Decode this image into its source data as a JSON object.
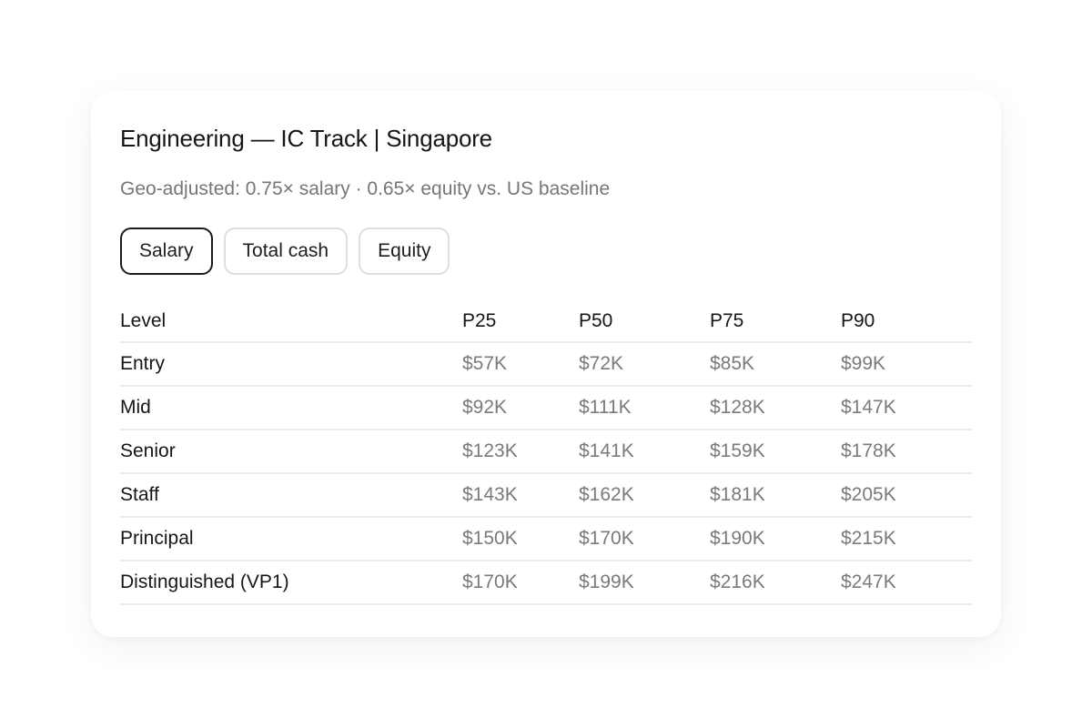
{
  "card": {
    "title": "Engineering — IC Track | Singapore",
    "subtitle": "Geo-adjusted: 0.75× salary · 0.65× equity vs. US baseline"
  },
  "tabs": [
    {
      "label": "Salary",
      "active": true
    },
    {
      "label": "Total cash",
      "active": false
    },
    {
      "label": "Equity",
      "active": false
    }
  ],
  "table": {
    "headers": [
      "Level",
      "P25",
      "P50",
      "P75",
      "P90"
    ],
    "rows": [
      {
        "level": "Entry",
        "p25": "$57K",
        "p50": "$72K",
        "p75": "$85K",
        "p90": "$99K"
      },
      {
        "level": "Mid",
        "p25": "$92K",
        "p50": "$111K",
        "p75": "$128K",
        "p90": "$147K"
      },
      {
        "level": "Senior",
        "p25": "$123K",
        "p50": "$141K",
        "p75": "$159K",
        "p90": "$178K"
      },
      {
        "level": "Staff",
        "p25": "$143K",
        "p50": "$162K",
        "p75": "$181K",
        "p90": "$205K"
      },
      {
        "level": "Principal",
        "p25": "$150K",
        "p50": "$170K",
        "p75": "$190K",
        "p90": "$215K"
      },
      {
        "level": "Distinguished (VP1)",
        "p25": "$170K",
        "p50": "$199K",
        "p75": "$216K",
        "p90": "$247K"
      }
    ]
  },
  "colors": {
    "active_tab_border": "#1a1a1a",
    "tab_border": "#dedede",
    "muted_text": "#767676",
    "row_divider": "#ececec"
  }
}
